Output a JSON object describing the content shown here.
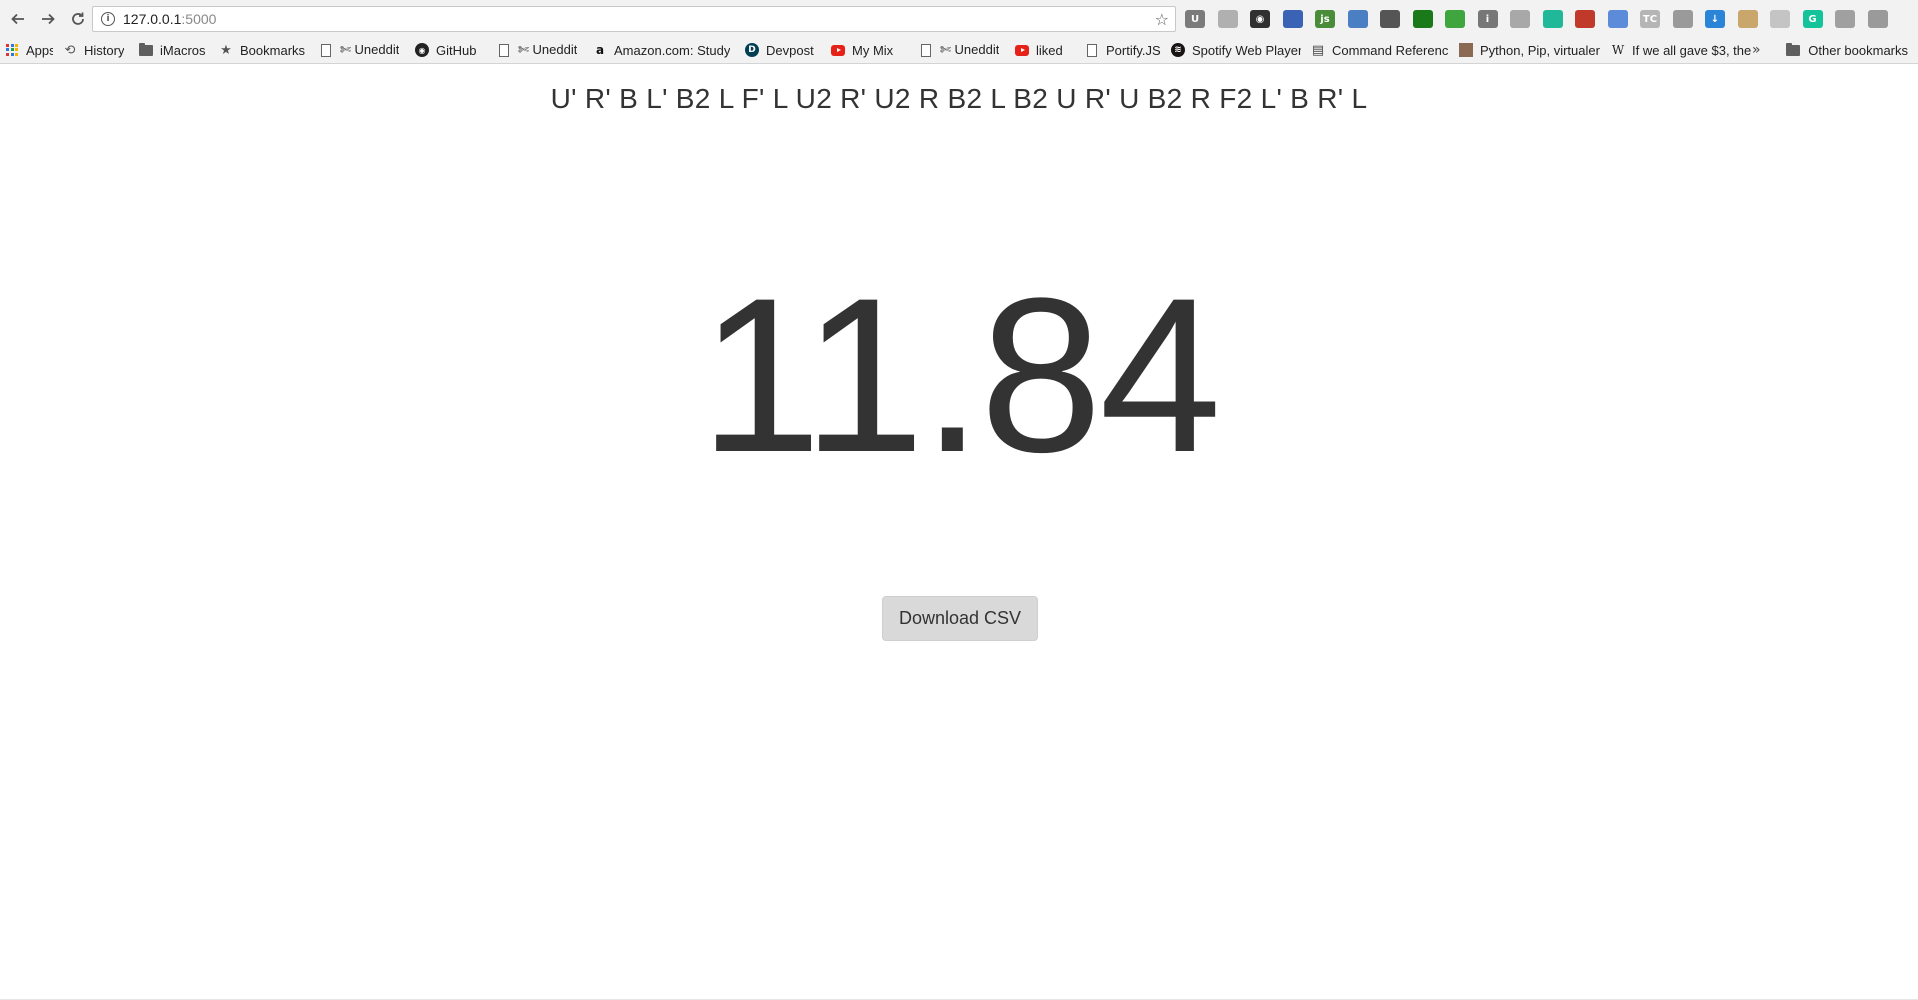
{
  "browser": {
    "url_host": "127.0.0.1",
    "url_port": ":5000",
    "extensions": [
      {
        "icon": "ublock-icon",
        "color": "#7b7b7b",
        "glyph": "U"
      },
      {
        "icon": "extension-icon",
        "color": "#b0b0b0",
        "glyph": ""
      },
      {
        "icon": "glasses-icon",
        "color": "#303030",
        "glyph": "◉"
      },
      {
        "icon": "globe-icon",
        "color": "#3a63b5",
        "glyph": ""
      },
      {
        "icon": "js-icon",
        "color": "#4a8c3a",
        "glyph": "js"
      },
      {
        "icon": "satellite-icon",
        "color": "#4b7fc4",
        "glyph": ""
      },
      {
        "icon": "circle-icon",
        "color": "#555555",
        "glyph": ""
      },
      {
        "icon": "terminal-icon",
        "color": "#1a7a1a",
        "glyph": ""
      },
      {
        "icon": "print-icon",
        "color": "#3fa63f",
        "glyph": ""
      },
      {
        "icon": "info-icon",
        "color": "#777777",
        "glyph": "i"
      },
      {
        "icon": "chart-icon",
        "color": "#a8a8a8",
        "glyph": ""
      },
      {
        "icon": "grammar-icon",
        "color": "#21b89a",
        "glyph": ""
      },
      {
        "icon": "calendar-icon",
        "color": "#c0392b",
        "glyph": ""
      },
      {
        "icon": "feather-icon",
        "color": "#5b8bd9",
        "glyph": ""
      },
      {
        "icon": "tc-icon",
        "color": "#b5b5b5",
        "glyph": "TC"
      },
      {
        "icon": "shield-icon",
        "color": "#9a9a9a",
        "glyph": ""
      },
      {
        "icon": "download-icon",
        "color": "#2a84d8",
        "glyph": "↓"
      },
      {
        "icon": "image-icon",
        "color": "#c9a66b",
        "glyph": ""
      },
      {
        "icon": "gray-square-icon",
        "color": "#c4c4c4",
        "glyph": ""
      },
      {
        "icon": "grammarly-icon",
        "color": "#15c39a",
        "glyph": "G"
      },
      {
        "icon": "sync-icon",
        "color": "#a0a0a0",
        "glyph": ""
      },
      {
        "icon": "camera-icon",
        "color": "#9a9a9a",
        "glyph": ""
      }
    ],
    "bookmarks": [
      {
        "label": "Apps",
        "type": "apps"
      },
      {
        "label": "History",
        "type": "history"
      },
      {
        "label": "iMacros",
        "type": "folder"
      },
      {
        "label": "Bookmarks",
        "type": "star"
      },
      {
        "label": "✄ Uneddit",
        "type": "page"
      },
      {
        "label": "GitHub",
        "type": "github"
      },
      {
        "label": "✄ Uneddit",
        "type": "page"
      },
      {
        "label": "Amazon.com: Study",
        "type": "amazon"
      },
      {
        "label": "Devpost",
        "type": "devpost"
      },
      {
        "label": "My Mix",
        "type": "youtube"
      },
      {
        "label": "✄ Uneddit",
        "type": "page"
      },
      {
        "label": "liked",
        "type": "youtube"
      },
      {
        "label": "Portify.JS",
        "type": "page"
      },
      {
        "label": "Spotify Web Player",
        "type": "spotify"
      },
      {
        "label": "Command Referenc",
        "type": "command"
      },
      {
        "label": "Python, Pip, virtualer",
        "type": "person"
      },
      {
        "label": "If we all gave $3, the",
        "type": "wiki"
      }
    ],
    "overflow": "»",
    "other_bookmarks": "Other bookmarks"
  },
  "page": {
    "scramble": "U' R' B L' B2 L F' L U2 R' U2 R B2 L B2 U R' U B2 R F2 L' B R' L",
    "time": "11.84",
    "download_button": "Download CSV"
  }
}
